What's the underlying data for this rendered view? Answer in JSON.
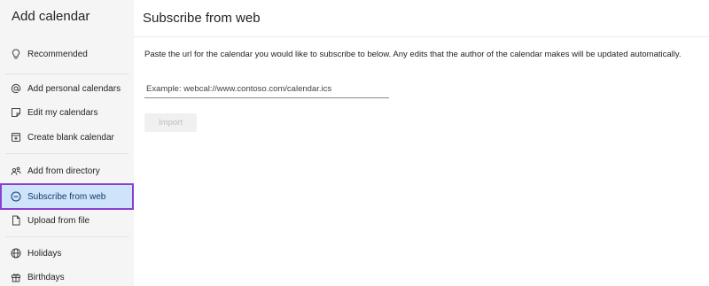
{
  "sidebar": {
    "title": "Add calendar",
    "items": [
      {
        "label": "Recommended",
        "icon": "lightbulb-icon"
      },
      {
        "label": "Add personal calendars",
        "icon": "at-sign-icon"
      },
      {
        "label": "Edit my calendars",
        "icon": "note-edit-icon"
      },
      {
        "label": "Create blank calendar",
        "icon": "calendar-add-icon"
      },
      {
        "label": "Add from directory",
        "icon": "people-icon"
      },
      {
        "label": "Subscribe from web",
        "icon": "link-circle-icon",
        "selected": true
      },
      {
        "label": "Upload from file",
        "icon": "document-icon"
      },
      {
        "label": "Holidays",
        "icon": "globe-icon"
      },
      {
        "label": "Birthdays",
        "icon": "gift-icon"
      }
    ]
  },
  "main": {
    "title": "Subscribe from web",
    "description": "Paste the url for the calendar you would like to subscribe to below. Any edits that the author of the calendar makes will be updated automatically.",
    "url_input": {
      "placeholder": "Example: webcal://www.contoso.com/calendar.ics",
      "value": ""
    },
    "import_label": "Import"
  },
  "colors": {
    "sidebar_bg": "#f5f5f5",
    "selected_bg": "#cfe4fa",
    "highlight_outline": "#8a3fd1",
    "disabled_text": "#bdbdbd"
  }
}
